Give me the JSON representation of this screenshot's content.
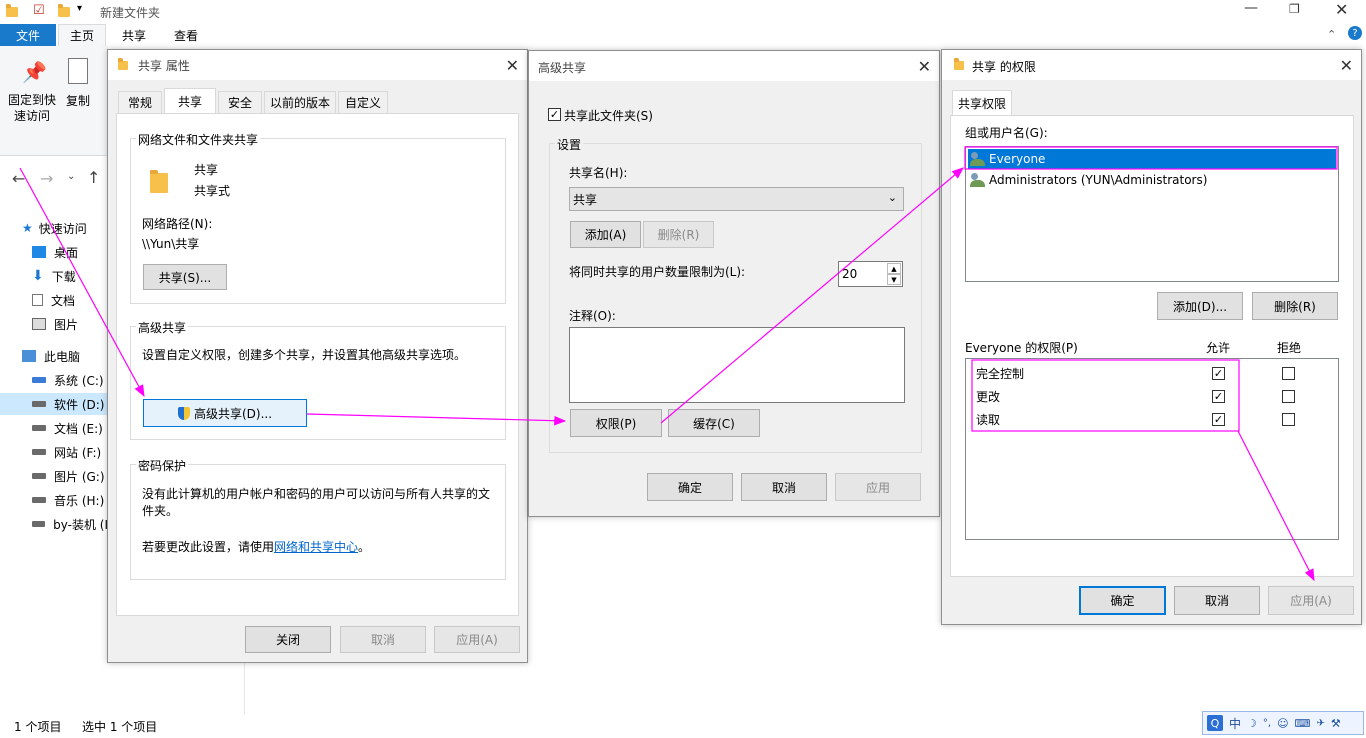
{
  "explorer": {
    "window_title": "新建文件夹",
    "ribbon_tabs": [
      "文件",
      "主页",
      "共享",
      "查看"
    ],
    "ribbon_pin": "固定到快速访问",
    "ribbon_copy": "复制",
    "nav": {
      "quick_access": "快速访问",
      "desktop": "桌面",
      "downloads": "下载",
      "documents": "文档",
      "pictures": "图片",
      "this_pc": "此电脑",
      "drives": [
        "系统 (C:)",
        "软件 (D:)",
        "文档 (E:)",
        "网站 (F:)",
        "图片 (G:)",
        "音乐 (H:)",
        "by-装机 (I"
      ]
    },
    "status_count": "1 个项目",
    "status_selected": "选中 1 个项目"
  },
  "props": {
    "title": "共享 属性",
    "tabs": [
      "常规",
      "共享",
      "安全",
      "以前的版本",
      "自定义"
    ],
    "group_net": "网络文件和文件夹共享",
    "folder_name": "共享",
    "folder_state": "共享式",
    "path_label": "网络路径(N):",
    "path_value": "\\\\Yun\\共享",
    "share_btn": "共享(S)...",
    "group_adv": "高级共享",
    "adv_desc": "设置自定义权限，创建多个共享，并设置其他高级共享选项。",
    "adv_btn": "高级共享(D)...",
    "group_pwd": "密码保护",
    "pwd_desc": "没有此计算机的用户帐户和密码的用户可以访问与所有人共享的文件夹。",
    "pwd_change_prefix": "若要更改此设置，请使用",
    "pwd_link": "网络和共享中心",
    "pwd_suffix": "。",
    "close_btn": "关闭",
    "cancel_btn": "取消",
    "apply_btn": "应用(A)"
  },
  "adv": {
    "title": "高级共享",
    "share_check": "共享此文件夹(S)",
    "settings": "设置",
    "share_name_label": "共享名(H):",
    "share_name_value": "共享",
    "add_btn": "添加(A)",
    "remove_btn": "删除(R)",
    "limit_label": "将同时共享的用户数量限制为(L):",
    "limit_value": "20",
    "comment_label": "注释(O):",
    "perm_btn": "权限(P)",
    "cache_btn": "缓存(C)",
    "ok_btn": "确定",
    "cancel_btn": "取消",
    "apply_btn": "应用"
  },
  "perm": {
    "title": "共享 的权限",
    "tab": "共享权限",
    "group_label": "组或用户名(G):",
    "users": [
      "Everyone",
      "Administrators (YUN\\Administrators)"
    ],
    "add_btn": "添加(D)...",
    "remove_btn": "删除(R)",
    "perm_for": "Everyone 的权限(P)",
    "allow": "允许",
    "deny": "拒绝",
    "rows": [
      {
        "name": "完全控制",
        "allow": "✓",
        "deny": ""
      },
      {
        "name": "更改",
        "allow": "✓",
        "deny": ""
      },
      {
        "name": "读取",
        "allow": "✓",
        "deny": ""
      }
    ],
    "ok_btn": "确定",
    "cancel_btn": "取消",
    "apply_btn": "应用(A)"
  },
  "ime": {
    "items": [
      "中",
      "☽",
      "°,",
      "☺",
      "⌨",
      "✈",
      "♚",
      "⚒"
    ]
  },
  "colors": {
    "accent": "#0078d7",
    "annotation": "#ff00ff",
    "folder": "#f6c04a"
  }
}
